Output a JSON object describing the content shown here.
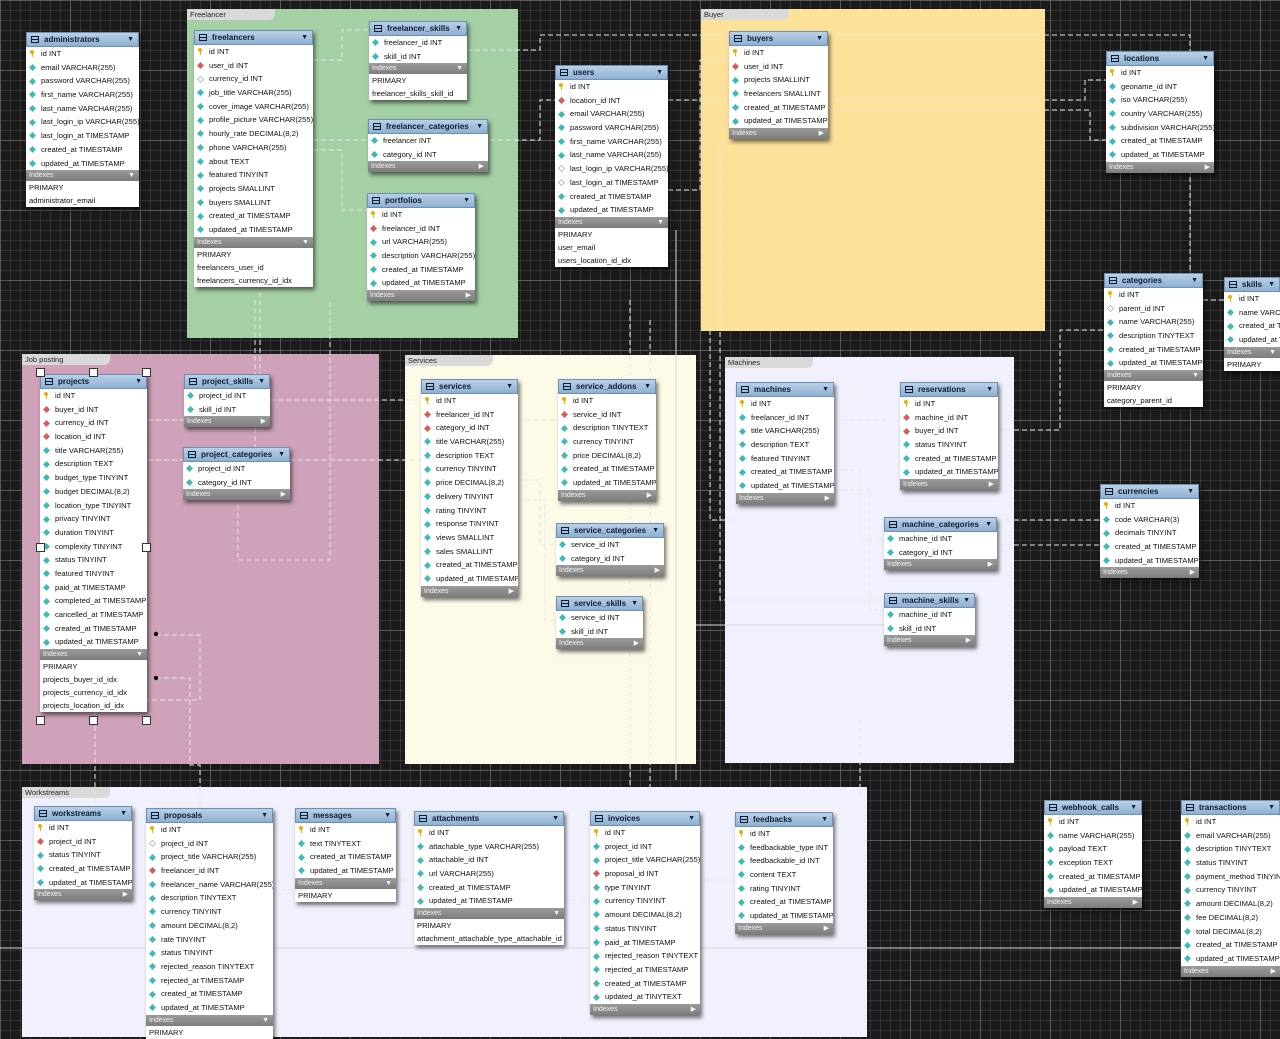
{
  "layers": [
    {
      "key": "freelancer",
      "title": "Freelancer",
      "color": "#a5d0a6"
    },
    {
      "key": "buyer",
      "title": "Buyer",
      "color": "#fde199"
    },
    {
      "key": "jobposting",
      "title": "Job posting",
      "color": "#d0a2b9"
    },
    {
      "key": "services",
      "title": "Services",
      "color": "#fdfbe7"
    },
    {
      "key": "machines",
      "title": "Machines",
      "color": "#f1f1fd"
    },
    {
      "key": "workstreams",
      "title": "Workstreams",
      "color": "#f1f1fd"
    }
  ],
  "icons": {
    "pk": "primary-key-icon",
    "fk": "foreign-key-icon",
    "col": "column-icon",
    "null": "nullable-column-icon",
    "table": "table-icon",
    "menu": "chevron-down-icon"
  },
  "indexes_label": "Indexes",
  "tables": [
    {
      "key": "administrators",
      "name": "administrators",
      "cols": [
        [
          "pk",
          "id INT"
        ],
        [
          "col",
          "email VARCHAR(255)"
        ],
        [
          "col",
          "password VARCHAR(255)"
        ],
        [
          "col",
          "first_name VARCHAR(255)"
        ],
        [
          "col",
          "last_name VARCHAR(255)"
        ],
        [
          "col",
          "last_login_ip VARCHAR(255)"
        ],
        [
          "col",
          "last_login_at TIMESTAMP"
        ],
        [
          "col",
          "created_at TIMESTAMP"
        ],
        [
          "col",
          "updated_at TIMESTAMP"
        ]
      ],
      "indexes": [
        "PRIMARY",
        "administrator_email"
      ]
    },
    {
      "key": "freelancers",
      "name": "freelancers",
      "cols": [
        [
          "pk",
          "id INT"
        ],
        [
          "fk",
          "user_id INT"
        ],
        [
          "null",
          "currency_id INT"
        ],
        [
          "col",
          "job_title VARCHAR(255)"
        ],
        [
          "col",
          "cover_image VARCHAR(255)"
        ],
        [
          "col",
          "profile_picture VARCHAR(255)"
        ],
        [
          "col",
          "hourly_rate DECIMAL(8,2)"
        ],
        [
          "col",
          "phone VARCHAR(255)"
        ],
        [
          "col",
          "about TEXT"
        ],
        [
          "col",
          "featured TINYINT"
        ],
        [
          "col",
          "projects SMALLINT"
        ],
        [
          "col",
          "buyers SMALLINT"
        ],
        [
          "col",
          "created_at TIMESTAMP"
        ],
        [
          "col",
          "updated_at TIMESTAMP"
        ]
      ],
      "indexes": [
        "PRIMARY",
        "freelancers_user_id",
        "freelancers_currency_id_idx"
      ]
    },
    {
      "key": "freelancer_skills",
      "name": "freelancer_skills",
      "cols": [
        [
          "col",
          "freelancer_id INT"
        ],
        [
          "col",
          "skill_id INT"
        ]
      ],
      "indexes": [
        "PRIMARY",
        "freelancer_skills_skill_id"
      ]
    },
    {
      "key": "freelancer_categories",
      "name": "freelancer_categories",
      "cols": [
        [
          "col",
          "freelancer INT"
        ],
        [
          "col",
          "category_id INT"
        ]
      ],
      "indexes": []
    },
    {
      "key": "portfolios",
      "name": "portfolios",
      "cols": [
        [
          "pk",
          "id INT"
        ],
        [
          "fk",
          "freelancer_id INT"
        ],
        [
          "col",
          "url VARCHAR(255)"
        ],
        [
          "col",
          "description VARCHAR(255)"
        ],
        [
          "col",
          "created_at TIMESTAMP"
        ],
        [
          "col",
          "updated_at TIMESTAMP"
        ]
      ],
      "indexes": []
    },
    {
      "key": "users",
      "name": "users",
      "cols": [
        [
          "pk",
          "id INT"
        ],
        [
          "fk",
          "location_id INT"
        ],
        [
          "col",
          "email VARCHAR(255)"
        ],
        [
          "col",
          "password VARCHAR(255)"
        ],
        [
          "col",
          "first_name VARCHAR(255)"
        ],
        [
          "col",
          "last_name VARCHAR(255)"
        ],
        [
          "null",
          "last_login_ip VARCHAR(255)"
        ],
        [
          "null",
          "last_login_at TIMESTAMP"
        ],
        [
          "col",
          "created_at TIMESTAMP"
        ],
        [
          "col",
          "updated_at TIMESTAMP"
        ]
      ],
      "indexes": [
        "PRIMARY",
        "user_email",
        "users_location_id_idx"
      ]
    },
    {
      "key": "buyers",
      "name": "buyers",
      "cols": [
        [
          "pk",
          "id INT"
        ],
        [
          "fk",
          "user_id INT"
        ],
        [
          "col",
          "projects SMALLINT"
        ],
        [
          "col",
          "freelancers SMALLINT"
        ],
        [
          "col",
          "created_at TIMESTAMP"
        ],
        [
          "col",
          "updated_at TIMESTAMP"
        ]
      ],
      "indexes": []
    },
    {
      "key": "locations",
      "name": "locations",
      "cols": [
        [
          "pk",
          "id INT"
        ],
        [
          "col",
          "geoname_id INT"
        ],
        [
          "col",
          "iso VARCHAR(255)"
        ],
        [
          "col",
          "country VARCHAR(255)"
        ],
        [
          "col",
          "subdivision VARCHAR(255)"
        ],
        [
          "col",
          "created_at TIMESTAMP"
        ],
        [
          "col",
          "updated_at TIMESTAMP"
        ]
      ],
      "indexes": []
    },
    {
      "key": "categories",
      "name": "categories",
      "cols": [
        [
          "pk",
          "id INT"
        ],
        [
          "null",
          "parent_id INT"
        ],
        [
          "col",
          "name VARCHAR(255)"
        ],
        [
          "col",
          "description TINYTEXT"
        ],
        [
          "col",
          "created_at TIMESTAMP"
        ],
        [
          "col",
          "updated_at TIMESTAMP"
        ]
      ],
      "indexes": [
        "PRIMARY",
        "category_parent_id"
      ]
    },
    {
      "key": "skills",
      "name": "skills",
      "cols": [
        [
          "pk",
          "id INT"
        ],
        [
          "col",
          "name VARC"
        ],
        [
          "col",
          "created_at T"
        ],
        [
          "col",
          "updated_at T"
        ]
      ],
      "indexes": [
        "PRIMARY"
      ]
    },
    {
      "key": "projects",
      "name": "projects",
      "cols": [
        [
          "pk",
          "id INT"
        ],
        [
          "fk",
          "buyer_id INT"
        ],
        [
          "fk",
          "currency_id INT"
        ],
        [
          "fk",
          "location_id INT"
        ],
        [
          "col",
          "title VARCHAR(255)"
        ],
        [
          "col",
          "description TEXT"
        ],
        [
          "col",
          "budget_type TINYINT"
        ],
        [
          "col",
          "budget DECIMAL(8,2)"
        ],
        [
          "col",
          "location_type TINYINT"
        ],
        [
          "col",
          "privacy TINYINT"
        ],
        [
          "col",
          "duration TINYINT"
        ],
        [
          "col",
          "complexity TINYINT"
        ],
        [
          "col",
          "status TINYINT"
        ],
        [
          "col",
          "featured TINYINT"
        ],
        [
          "col",
          "paid_at TIMESTAMP"
        ],
        [
          "col",
          "completed_at TIMESTAMP"
        ],
        [
          "col",
          "cancelled_at TIMESTAMP"
        ],
        [
          "col",
          "created_at TIMESTAMP"
        ],
        [
          "col",
          "updated_at TIMESTAMP"
        ]
      ],
      "indexes": [
        "PRIMARY",
        "projects_buyer_id_idx",
        "projects_currency_id_idx",
        "projects_location_id_idx"
      ]
    },
    {
      "key": "project_skills",
      "name": "project_skills",
      "cols": [
        [
          "col",
          "project_id INT"
        ],
        [
          "col",
          "skill_id INT"
        ]
      ],
      "indexes": []
    },
    {
      "key": "project_categories",
      "name": "project_categories",
      "cols": [
        [
          "col",
          "project_id INT"
        ],
        [
          "col",
          "category_id INT"
        ]
      ],
      "indexes": []
    },
    {
      "key": "services",
      "name": "services",
      "cols": [
        [
          "pk",
          "id INT"
        ],
        [
          "fk",
          "freelancer_id INT"
        ],
        [
          "fk",
          "category_id INT"
        ],
        [
          "col",
          "title VARCHAR(255)"
        ],
        [
          "col",
          "description TEXT"
        ],
        [
          "col",
          "currency TINYINT"
        ],
        [
          "col",
          "price DECIMAL(8,2)"
        ],
        [
          "col",
          "delivery TINYINT"
        ],
        [
          "col",
          "rating TINYINT"
        ],
        [
          "col",
          "response TINYINT"
        ],
        [
          "col",
          "views SMALLINT"
        ],
        [
          "col",
          "sales SMALLINT"
        ],
        [
          "col",
          "created_at TIMESTAMP"
        ],
        [
          "col",
          "updated_at TIMESTAMP"
        ]
      ],
      "indexes": []
    },
    {
      "key": "service_addons",
      "name": "service_addons",
      "cols": [
        [
          "pk",
          "id INT"
        ],
        [
          "fk",
          "service_id INT"
        ],
        [
          "col",
          "description TINYTEXT"
        ],
        [
          "col",
          "currency TINYINT"
        ],
        [
          "col",
          "price DECIMAL(8,2)"
        ],
        [
          "col",
          "created_at TIMESTAMP"
        ],
        [
          "col",
          "updated_at TIMESTAMP"
        ]
      ],
      "indexes": []
    },
    {
      "key": "service_categories",
      "name": "service_categories",
      "cols": [
        [
          "col",
          "service_id INT"
        ],
        [
          "col",
          "category_id INT"
        ]
      ],
      "indexes": []
    },
    {
      "key": "service_skills",
      "name": "service_skills",
      "cols": [
        [
          "col",
          "service_id INT"
        ],
        [
          "col",
          "skill_id INT"
        ]
      ],
      "indexes": []
    },
    {
      "key": "machines",
      "name": "machines",
      "cols": [
        [
          "pk",
          "id INT"
        ],
        [
          "col",
          "freelancer_id INT"
        ],
        [
          "col",
          "title VARCHAR(255)"
        ],
        [
          "col",
          "description TEXT"
        ],
        [
          "col",
          "featured TINYINT"
        ],
        [
          "col",
          "created_at TIMESTAMP"
        ],
        [
          "col",
          "updated_at TIMESTAMP"
        ]
      ],
      "indexes": []
    },
    {
      "key": "reservations",
      "name": "reservations",
      "cols": [
        [
          "pk",
          "id INT"
        ],
        [
          "fk",
          "machine_id INT"
        ],
        [
          "fk",
          "buyer_id INT"
        ],
        [
          "col",
          "status TINYINT"
        ],
        [
          "col",
          "created_at TIMESTAMP"
        ],
        [
          "col",
          "updated_at TIMESTAMP"
        ]
      ],
      "indexes": []
    },
    {
      "key": "machine_categories",
      "name": "machine_categories",
      "cols": [
        [
          "col",
          "machine_id INT"
        ],
        [
          "col",
          "category_id INT"
        ]
      ],
      "indexes": []
    },
    {
      "key": "machine_skills",
      "name": "machine_skills",
      "cols": [
        [
          "col",
          "machine_id INT"
        ],
        [
          "col",
          "skill_id INT"
        ]
      ],
      "indexes": []
    },
    {
      "key": "currencies",
      "name": "currencies",
      "cols": [
        [
          "pk",
          "id INT"
        ],
        [
          "col",
          "code VARCHAR(3)"
        ],
        [
          "col",
          "decimals TINYINT"
        ],
        [
          "col",
          "created_at TIMESTAMP"
        ],
        [
          "col",
          "updated_at TIMESTAMP"
        ]
      ],
      "indexes": []
    },
    {
      "key": "workstreams",
      "name": "workstreams",
      "cols": [
        [
          "pk",
          "id INT"
        ],
        [
          "fk",
          "project_id INT"
        ],
        [
          "col",
          "status TINYINT"
        ],
        [
          "col",
          "created_at TIMESTAMP"
        ],
        [
          "col",
          "updated_at TIMESTAMP"
        ]
      ],
      "indexes": []
    },
    {
      "key": "proposals",
      "name": "proposals",
      "cols": [
        [
          "pk",
          "id INT"
        ],
        [
          "null",
          "project_id INT"
        ],
        [
          "col",
          "project_title VARCHAR(255)"
        ],
        [
          "fk",
          "freelancer_id INT"
        ],
        [
          "col",
          "freelancer_name VARCHAR(255)"
        ],
        [
          "col",
          "description TINYTEXT"
        ],
        [
          "col",
          "currency TINYINT"
        ],
        [
          "col",
          "amount DECIMAL(8,2)"
        ],
        [
          "col",
          "rate TINYINT"
        ],
        [
          "col",
          "status TINYINT"
        ],
        [
          "col",
          "rejected_reason TINYTEXT"
        ],
        [
          "col",
          "rejected_at TIMESTAMP"
        ],
        [
          "col",
          "created_at TIMESTAMP"
        ],
        [
          "col",
          "updated_at TIMESTAMP"
        ]
      ],
      "indexes": [
        "PRIMARY"
      ]
    },
    {
      "key": "messages",
      "name": "messages",
      "cols": [
        [
          "pk",
          "id INT"
        ],
        [
          "col",
          "text TINYTEXT"
        ],
        [
          "col",
          "created_at TIMESTAMP"
        ],
        [
          "col",
          "updated_at TIMESTAMP"
        ]
      ],
      "indexes": [
        "PRIMARY"
      ]
    },
    {
      "key": "attachments",
      "name": "attachments",
      "cols": [
        [
          "pk",
          "id INT"
        ],
        [
          "col",
          "attachable_type VARCHAR(255)"
        ],
        [
          "col",
          "attachable_id INT"
        ],
        [
          "col",
          "url VARCHAR(255)"
        ],
        [
          "col",
          "created_at TIMESTAMP"
        ],
        [
          "col",
          "updated_at TIMESTAMP"
        ]
      ],
      "indexes": [
        "PRIMARY",
        "attachment_attachable_type_attachable_id"
      ]
    },
    {
      "key": "invoices",
      "name": "invoices",
      "cols": [
        [
          "pk",
          "id INT"
        ],
        [
          "col",
          "project_id INT"
        ],
        [
          "col",
          "project_title VARCHAR(255)"
        ],
        [
          "fk",
          "proposal_id INT"
        ],
        [
          "col",
          "type TINYINT"
        ],
        [
          "col",
          "currency TINYINT"
        ],
        [
          "col",
          "amount DECIMAL(8,2)"
        ],
        [
          "col",
          "status TINYINT"
        ],
        [
          "col",
          "paid_at TIMESTAMP"
        ],
        [
          "col",
          "rejected_reason TINYTEXT"
        ],
        [
          "col",
          "rejected_at TIMESTAMP"
        ],
        [
          "col",
          "created_at TIMESTAMP"
        ],
        [
          "col",
          "updated_at TINYTEXT"
        ]
      ],
      "indexes": []
    },
    {
      "key": "feedbacks",
      "name": "feedbacks",
      "cols": [
        [
          "pk",
          "id INT"
        ],
        [
          "col",
          "feedbackable_type INT"
        ],
        [
          "col",
          "feedbackable_id INT"
        ],
        [
          "col",
          "content TEXT"
        ],
        [
          "col",
          "rating TINYINT"
        ],
        [
          "col",
          "created_at TIMESTAMP"
        ],
        [
          "col",
          "updated_at TIMESTAMP"
        ]
      ],
      "indexes": []
    },
    {
      "key": "webhook_calls",
      "name": "webhook_calls",
      "cols": [
        [
          "pk",
          "id INT"
        ],
        [
          "col",
          "name VARCHAR(255)"
        ],
        [
          "col",
          "payload TEXT"
        ],
        [
          "col",
          "exception TEXT"
        ],
        [
          "col",
          "created_at TIMESTAMP"
        ],
        [
          "col",
          "updated_at TIMESTAMP"
        ]
      ],
      "indexes": []
    },
    {
      "key": "transactions",
      "name": "transactions",
      "cols": [
        [
          "pk",
          "id INT"
        ],
        [
          "col",
          "email VARCHAR(255)"
        ],
        [
          "col",
          "description TINYTEXT"
        ],
        [
          "col",
          "status TINYINT"
        ],
        [
          "col",
          "payment_method TINYIN"
        ],
        [
          "col",
          "currency TINYINT"
        ],
        [
          "col",
          "amount DECIMAL(8,2)"
        ],
        [
          "col",
          "fee DECIMAL(8,2)"
        ],
        [
          "col",
          "total DECIMAL(8,2)"
        ],
        [
          "col",
          "created_at TIMESTAMP"
        ],
        [
          "col",
          "updated_at TIMESTAMP"
        ]
      ],
      "indexes": []
    }
  ]
}
